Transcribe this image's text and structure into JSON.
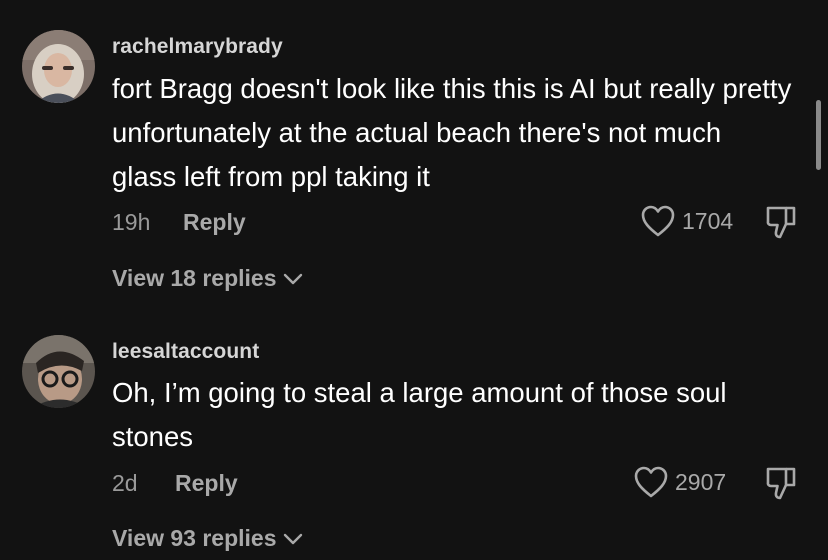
{
  "comments": [
    {
      "username": "rachelmarybrady",
      "text": "fort Bragg doesn't look like this this is AI but really pretty unfortunately at the actual beach there's not much glass left from ppl taking it",
      "time": "19h",
      "reply_label": "Reply",
      "likes": "1704",
      "view_replies": "View 18 replies",
      "like_icon": "heart-outline-icon",
      "dislike_icon": "thumbs-down-icon"
    },
    {
      "username": "leesaltaccount",
      "text": "Oh, I’m going to steal a large amount of those soul stones",
      "time": "2d",
      "reply_label": "Reply",
      "likes": "2907",
      "view_replies": "View 93 replies",
      "like_icon": "heart-outline-icon",
      "dislike_icon": "thumbs-down-icon"
    }
  ],
  "colors": {
    "background": "#121212",
    "username": "#d6d6d6",
    "text": "#ffffff",
    "secondary": "#a9a9a9"
  }
}
